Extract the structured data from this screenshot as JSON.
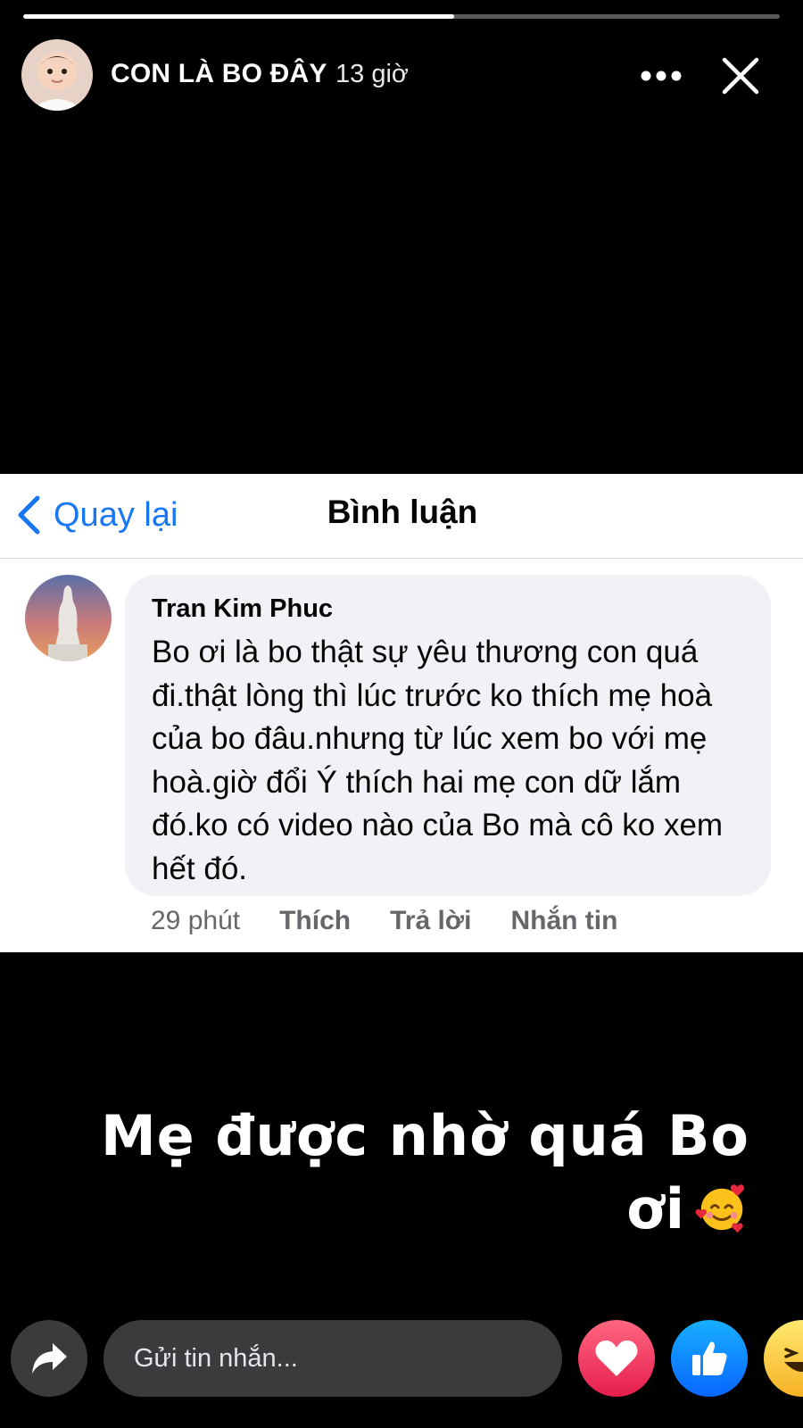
{
  "story": {
    "progress": 0.57,
    "user_name": "CON LÀ BO ĐÂY",
    "time_ago": "13 giờ"
  },
  "screenshot": {
    "back_label": "Quay lại",
    "title": "Bình luận",
    "comment": {
      "author": "Tran Kim Phuc",
      "text": "Bo ơi là bo thật sự yêu thương con quá đi.thật lòng thì lúc trước ko thích mẹ hoà của bo đâu.nhưng từ lúc xem bo với mẹ hoà.giờ đổi Ý thích hai mẹ con dữ lắm đó.ko có video nào của Bo mà cô ko xem hết đó.",
      "time": "29 phút",
      "like_label": "Thích",
      "reply_label": "Trả lời",
      "message_label": "Nhắn tin"
    }
  },
  "caption": {
    "line1": "Mẹ được nhờ quá Bo",
    "line2": "ơi"
  },
  "composer": {
    "placeholder": "Gửi tin nhắn..."
  },
  "colors": {
    "accent": "#1877f2",
    "love": "#e61e4d",
    "like": "#0866ff",
    "haha": "#f7b125"
  }
}
